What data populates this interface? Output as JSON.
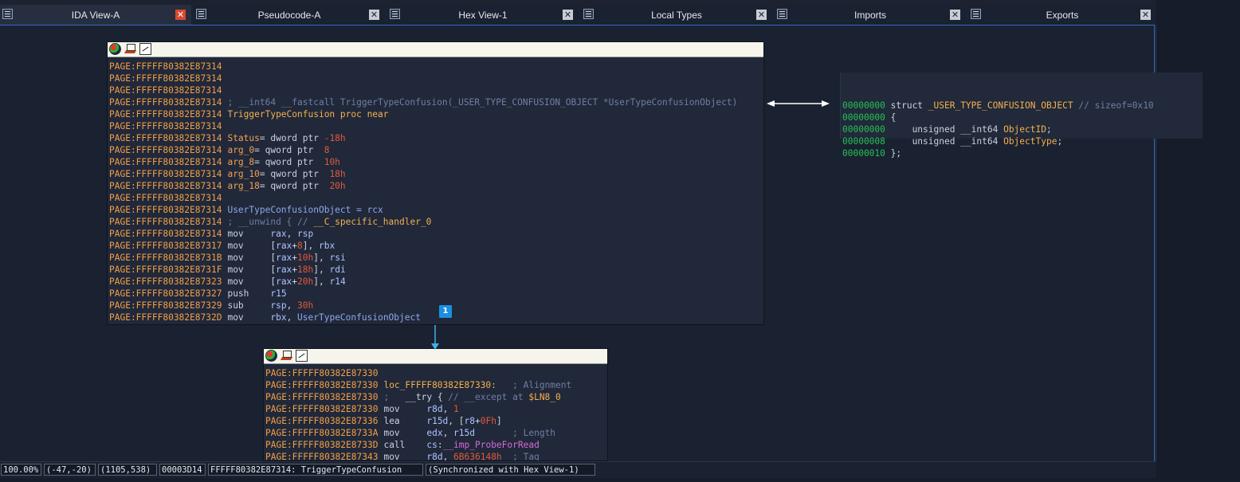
{
  "tabs": [
    {
      "label": "IDA View-A",
      "active": true
    },
    {
      "label": "Pseudocode-A",
      "active": false
    },
    {
      "label": "Hex View-1",
      "active": false
    },
    {
      "label": "Local Types",
      "active": false
    },
    {
      "label": "Imports",
      "active": false
    },
    {
      "label": "Exports",
      "active": false
    }
  ],
  "close_glyph": "✕",
  "node1": {
    "lines": [
      {
        "a": "PAGE:FFFFF80382E87314",
        "segs": []
      },
      {
        "a": "PAGE:FFFFF80382E87314",
        "segs": []
      },
      {
        "a": "PAGE:FFFFF80382E87314",
        "segs": []
      },
      {
        "a": "PAGE:FFFFF80382E87314",
        "segs": [
          [
            "cmt",
            "; __int64 __fastcall TriggerTypeConfusion(_USER_TYPE_CONFUSION_OBJECT *UserTypeConfusionObject)"
          ]
        ]
      },
      {
        "a": "PAGE:FFFFF80382E87314",
        "segs": [
          [
            "fn",
            "TriggerTypeConfusion proc near"
          ]
        ]
      },
      {
        "a": "PAGE:FFFFF80382E87314",
        "segs": []
      },
      {
        "a": "PAGE:FFFFF80382E87314",
        "segs": [
          [
            "var",
            "Status"
          ],
          [
            "txt",
            "= dword ptr "
          ],
          [
            "num",
            "-18h"
          ]
        ]
      },
      {
        "a": "PAGE:FFFFF80382E87314",
        "segs": [
          [
            "var",
            "arg_0"
          ],
          [
            "txt",
            "= qword ptr  "
          ],
          [
            "num",
            "8"
          ]
        ]
      },
      {
        "a": "PAGE:FFFFF80382E87314",
        "segs": [
          [
            "var",
            "arg_8"
          ],
          [
            "txt",
            "= qword ptr  "
          ],
          [
            "num",
            "10h"
          ]
        ]
      },
      {
        "a": "PAGE:FFFFF80382E87314",
        "segs": [
          [
            "var",
            "arg_10"
          ],
          [
            "txt",
            "= qword ptr  "
          ],
          [
            "num",
            "18h"
          ]
        ]
      },
      {
        "a": "PAGE:FFFFF80382E87314",
        "segs": [
          [
            "var",
            "arg_18"
          ],
          [
            "txt",
            "= qword ptr  "
          ],
          [
            "num",
            "20h"
          ]
        ]
      },
      {
        "a": "PAGE:FFFFF80382E87314",
        "segs": []
      },
      {
        "a": "PAGE:FFFFF80382E87314",
        "segs": [
          [
            "ident",
            "UserTypeConfusionObject = rcx"
          ]
        ]
      },
      {
        "a": "PAGE:FFFFF80382E87314",
        "segs": [
          [
            "cmt",
            "; __unwind { // "
          ],
          [
            "fn",
            "__C_specific_handler_0"
          ]
        ]
      },
      {
        "a": "PAGE:FFFFF80382E87314",
        "segs": [
          [
            "txt",
            "mov     "
          ],
          [
            "reg",
            "rax"
          ],
          [
            "txt",
            ", "
          ],
          [
            "reg",
            "rsp"
          ]
        ]
      },
      {
        "a": "PAGE:FFFFF80382E87317",
        "segs": [
          [
            "txt",
            "mov     ["
          ],
          [
            "reg",
            "rax"
          ],
          [
            "txt",
            "+"
          ],
          [
            "num",
            "8"
          ],
          [
            "txt",
            "], "
          ],
          [
            "reg",
            "rbx"
          ]
        ]
      },
      {
        "a": "PAGE:FFFFF80382E8731B",
        "segs": [
          [
            "txt",
            "mov     ["
          ],
          [
            "reg",
            "rax"
          ],
          [
            "txt",
            "+"
          ],
          [
            "num",
            "10h"
          ],
          [
            "txt",
            "], "
          ],
          [
            "reg",
            "rsi"
          ]
        ]
      },
      {
        "a": "PAGE:FFFFF80382E8731F",
        "segs": [
          [
            "txt",
            "mov     ["
          ],
          [
            "reg",
            "rax"
          ],
          [
            "txt",
            "+"
          ],
          [
            "num",
            "18h"
          ],
          [
            "txt",
            "], "
          ],
          [
            "reg",
            "rdi"
          ]
        ]
      },
      {
        "a": "PAGE:FFFFF80382E87323",
        "segs": [
          [
            "txt",
            "mov     ["
          ],
          [
            "reg",
            "rax"
          ],
          [
            "txt",
            "+"
          ],
          [
            "num",
            "20h"
          ],
          [
            "txt",
            "], "
          ],
          [
            "reg",
            "r14"
          ]
        ]
      },
      {
        "a": "PAGE:FFFFF80382E87327",
        "segs": [
          [
            "txt",
            "push    "
          ],
          [
            "reg",
            "r15"
          ]
        ]
      },
      {
        "a": "PAGE:FFFFF80382E87329",
        "segs": [
          [
            "txt",
            "sub     "
          ],
          [
            "reg",
            "rsp"
          ],
          [
            "txt",
            ", "
          ],
          [
            "num",
            "30h"
          ]
        ]
      },
      {
        "a": "PAGE:FFFFF80382E8732D",
        "segs": [
          [
            "txt",
            "mov     "
          ],
          [
            "reg",
            "rbx"
          ],
          [
            "txt",
            ", "
          ],
          [
            "ident",
            "UserTypeConfusionObject"
          ]
        ]
      }
    ],
    "badge": "1"
  },
  "node2": {
    "lines": [
      {
        "a": "PAGE:FFFFF80382E87330",
        "segs": []
      },
      {
        "a": "PAGE:FFFFF80382E87330",
        "segs": [
          [
            "lbl",
            "loc_FFFFF80382E87330:"
          ],
          [
            "txt",
            "   "
          ],
          [
            "cmt",
            "; Alignment"
          ]
        ]
      },
      {
        "a": "PAGE:FFFFF80382E87330",
        "segs": [
          [
            "cmt",
            ";   "
          ],
          [
            "txt",
            "__try { "
          ],
          [
            "cmt",
            "// __except at "
          ],
          [
            "fn",
            "$LN8_0"
          ]
        ]
      },
      {
        "a": "PAGE:FFFFF80382E87330",
        "segs": [
          [
            "txt",
            "mov     "
          ],
          [
            "reg",
            "r8d"
          ],
          [
            "txt",
            ", "
          ],
          [
            "num",
            "1"
          ]
        ]
      },
      {
        "a": "PAGE:FFFFF80382E87336",
        "segs": [
          [
            "txt",
            "lea     "
          ],
          [
            "reg",
            "r15d"
          ],
          [
            "txt",
            ", ["
          ],
          [
            "reg",
            "r8"
          ],
          [
            "txt",
            "+"
          ],
          [
            "num",
            "0Fh"
          ],
          [
            "txt",
            "]"
          ]
        ]
      },
      {
        "a": "PAGE:FFFFF80382E8733A",
        "segs": [
          [
            "txt",
            "mov     "
          ],
          [
            "reg",
            "edx"
          ],
          [
            "txt",
            ", "
          ],
          [
            "reg",
            "r15d"
          ],
          [
            "txt",
            "       "
          ],
          [
            "cmt",
            "; Length"
          ]
        ]
      },
      {
        "a": "PAGE:FFFFF80382E8733D",
        "segs": [
          [
            "txt",
            "call    "
          ],
          [
            "reg",
            "cs"
          ],
          [
            "txt",
            ":"
          ],
          [
            "import",
            "__imp_ProbeForRead"
          ]
        ]
      },
      {
        "a": "PAGE:FFFFF80382E87343",
        "segs": [
          [
            "txt",
            "mov     "
          ],
          [
            "reg",
            "r8d"
          ],
          [
            "txt",
            ", "
          ],
          [
            "num",
            "6B636148h"
          ],
          [
            "txt",
            "  "
          ],
          [
            "cmt",
            "; Tag"
          ]
        ]
      }
    ]
  },
  "struct": {
    "lines": [
      {
        "off": "00000000",
        "segs": [
          [
            "skw",
            " struct "
          ],
          [
            "sname",
            "_USER_TYPE_CONFUSION_OBJECT"
          ],
          [
            "scmt",
            " // sizeof=0x10"
          ]
        ]
      },
      {
        "off": "00000000",
        "segs": [
          [
            "skw",
            " {"
          ]
        ]
      },
      {
        "off": "00000000",
        "segs": [
          [
            "skw",
            "     unsigned __int64 "
          ],
          [
            "sname",
            "ObjectID"
          ],
          [
            "skw",
            ";"
          ]
        ]
      },
      {
        "off": "00000008",
        "segs": [
          [
            "skw",
            "     unsigned __int64 "
          ],
          [
            "sname",
            "ObjectType"
          ],
          [
            "skw",
            ";"
          ]
        ]
      },
      {
        "off": "00000010",
        "segs": [
          [
            "skw",
            " };"
          ]
        ]
      }
    ]
  },
  "status": {
    "zoom": "100.00%",
    "graph_pos": "(-47,-20)",
    "mouse_pos": "(1105,538)",
    "file_offset": "00003D14",
    "location": "FFFFF80382E87314: TriggerTypeConfusion",
    "sync": "(Synchronized with Hex View-1)"
  },
  "colors": {
    "accent_frame": "#2f6bc4",
    "arrow": "#3fb0e8",
    "badge": "#1a8fe0",
    "active_close": "#d9482f"
  }
}
